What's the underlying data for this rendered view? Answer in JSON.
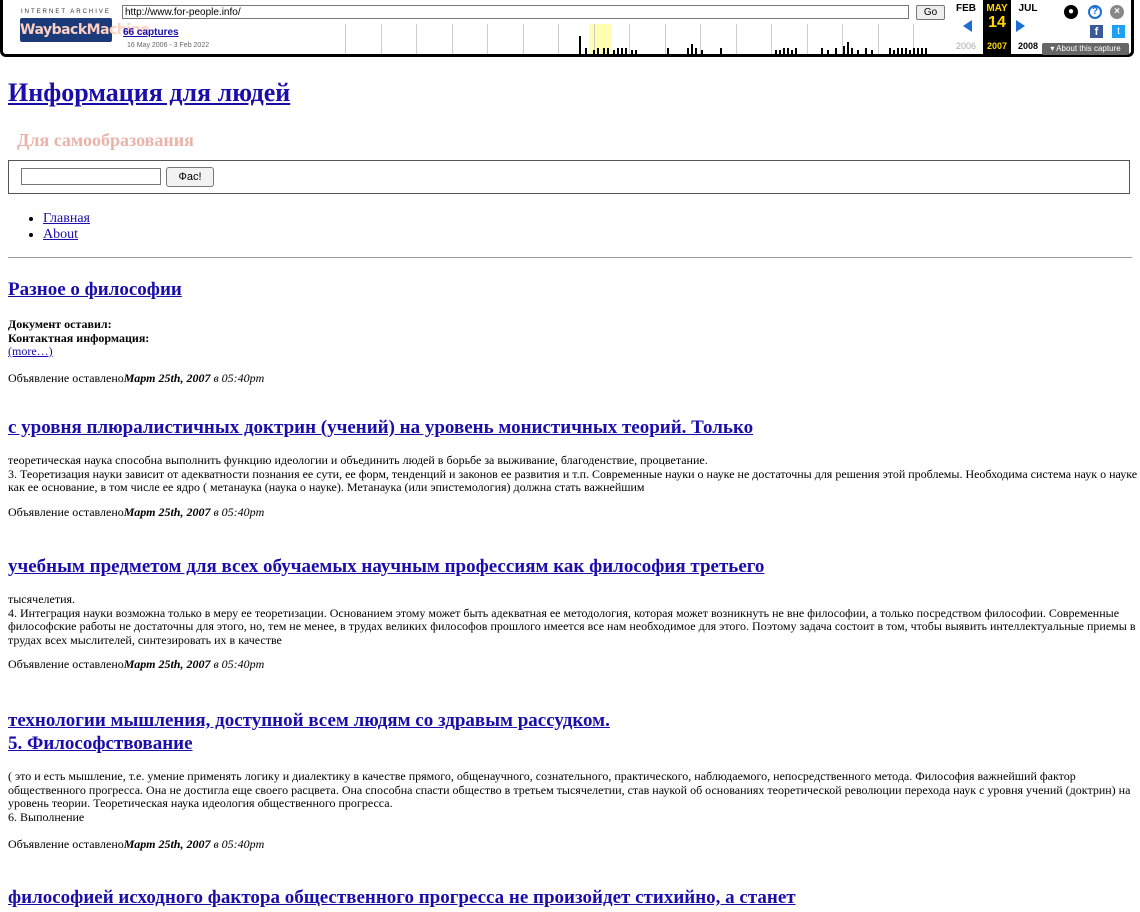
{
  "wayback": {
    "ia_text": "INTERNET ARCHIVE",
    "logo_text": "WaybackMachine",
    "url": "http://www.for-people.info/",
    "go_label": "Go",
    "captures": "66 captures",
    "date_range": "16 May 2006 - 3 Feb 2022",
    "prev_month": "FEB",
    "prev_year": "2006",
    "cur_month": "MAY",
    "cur_day": "14",
    "cur_year": "2007",
    "next_month": "JUL",
    "next_year": "2008",
    "about_capture": "▾ About this capture"
  },
  "site": {
    "title": "Информация для людей",
    "tagline": "Для самообразования",
    "search_button": "Фас!",
    "nav": [
      "Главная",
      "About"
    ]
  },
  "posts": [
    {
      "title": "Разное о философии",
      "lines": [
        "Документ оставил:",
        "Контактная информация:"
      ],
      "more": "(more…)",
      "meta_prefix": "Объявление оставлено",
      "meta_date": "Март 25th, 2007",
      "meta_time": "в 05:40pm"
    },
    {
      "title": "с уровня плюралистичных доктрин (учений) на уровень монистичных теорий. Только",
      "body": "теоретическая наука способна выполнить функцию идеологии и объединить людей в борьбе за выживание, благоденствие, процветание.\n3. Теоретизация науки зависит от адекватности познания ее сути, ее форм, тенденций и законов ее развития и т.п. Современные науки о науке не достаточны для решения этой проблемы. Необходима система наук о науке как ее основание, в том числе ее ядро ( метанаука (наука о науке). Метанаука (или эпистемология) должна стать важнейшим",
      "meta_prefix": "Объявление оставлено",
      "meta_date": "Март 25th, 2007",
      "meta_time": "в 05:40pm"
    },
    {
      "title": "учебным предметом для всех обучаемых научным профессиям как философия третьего",
      "body": "тысячелетия.\n4. Интеграция науки возможна только в меру ее теоретизации. Основанием этому может быть адекватная ее методология, которая может возникнуть не вне философии, а только посредством философии. Современные философские работы не достаточны для этого, но, тем не менее, в трудах великих философов прошлого имеется все нам необходимое для этого. Поэтому задача состоит в том, чтобы выявить интеллектуальные приемы в трудах всех мыслителей, синтезировать их в качестве",
      "meta_prefix": "Объявление оставлено",
      "meta_date": "Март 25th, 2007",
      "meta_time": "в 05:40pm"
    },
    {
      "title": "технологии мышления, доступной всем людям со здравым рассудком.",
      "title2": "5. Философствование",
      "body": "( это и есть мышление, т.е. умение применять логику и диалектику в качестве прямого, общенаучного, сознательного, практического, наблюдаемого, непосредственного метода. Философия важнейший фактор общественного прогресса. Она не достигла еще своего расцвета. Она способна спасти общество в третьем тысячелетии, став наукой об основаниях теоретической революции перехода наук с уровня учений (доктрин) на уровень теории. Теоретическая наука идеология общественного прогресса.\n6. Выполнение",
      "meta_prefix": "Объявление оставлено",
      "meta_date": "Март 25th, 2007",
      "meta_time": "в 05:40pm"
    },
    {
      "title": "философией исходного фактора общественного прогресса не произойдет стихийно, а станет"
    }
  ]
}
